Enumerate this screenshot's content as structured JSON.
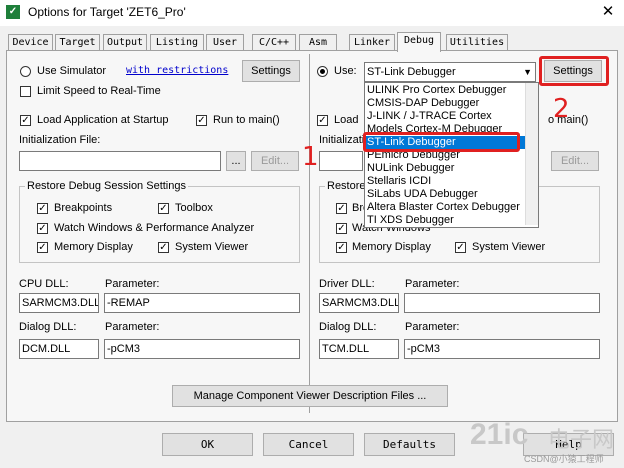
{
  "window": {
    "title": "Options for Target 'ZET6_Pro'",
    "close_glyph": "✕",
    "icon_glyph": "✓"
  },
  "tabs": [
    {
      "label": "Device"
    },
    {
      "label": "Target"
    },
    {
      "label": "Output"
    },
    {
      "label": "Listing"
    },
    {
      "label": "User"
    },
    {
      "label": "C/C++"
    },
    {
      "label": "Asm"
    },
    {
      "label": "Linker"
    },
    {
      "label": "Debug",
      "active": true
    },
    {
      "label": "Utilities"
    }
  ],
  "left": {
    "use_simulator": "Use Simulator",
    "with_restrictions": "with restrictions",
    "settings": "Settings",
    "limit_speed": "Limit Speed to Real-Time",
    "load_app": "Load Application at Startup",
    "run_to_main": "Run to main()",
    "init_file": "Initialization File:",
    "browse": "...",
    "edit": "Edit...",
    "restore_title": "Restore Debug Session Settings",
    "breakpoints": "Breakpoints",
    "toolbox": "Toolbox",
    "watch": "Watch Windows & Performance Analyzer",
    "memory": "Memory Display",
    "system_viewer": "System Viewer",
    "cpu_dll_label": "CPU DLL:",
    "param_label": "Parameter:",
    "cpu_dll": "SARMCM3.DLL",
    "cpu_param": "-REMAP",
    "dialog_dll_label": "Dialog DLL:",
    "dialog_dll": "DCM.DLL",
    "dialog_param": "-pCM3"
  },
  "right": {
    "use": "Use:",
    "debugger_selected": "ST-Link Debugger",
    "settings": "Settings",
    "load": "Load",
    "run_to_main_partial": "o main()",
    "init_partial": "Initializati",
    "edit": "Edit...",
    "restore_partial": "Restore",
    "breakpoints_partial": "Bre",
    "watch_partial": "Watch Windows",
    "memory": "Memory Display",
    "system_viewer": "System Viewer",
    "driver_dll_label": "Driver DLL:",
    "param_label": "Parameter:",
    "driver_dll": "SARMCM3.DLL",
    "driver_param": "",
    "dialog_dll_label": "Dialog DLL:",
    "dialog_dll": "TCM.DLL",
    "dialog_param": "-pCM3"
  },
  "dropdown": {
    "items": [
      "ULINK Pro Cortex Debugger",
      "CMSIS-DAP Debugger",
      "J-LINK / J-TRACE Cortex",
      "Models Cortex-M Debugger",
      "ST-Link Debugger",
      "PEmicro Debugger",
      "NULink Debugger",
      "Stellaris ICDI",
      "SiLabs UDA Debugger",
      "Altera Blaster Cortex Debugger",
      "TI XDS Debugger"
    ],
    "selected_index": 4
  },
  "manage_button": "Manage Component Viewer Description Files ...",
  "bottom": {
    "ok": "OK",
    "cancel": "Cancel",
    "defaults": "Defaults",
    "help": "Help"
  },
  "annotations": {
    "one": "1",
    "two": "2"
  },
  "watermark": {
    "text1": "21ic",
    "text2": "电子网",
    "text3": "CSDN@小猿工程师"
  },
  "check_glyph": "✓",
  "arrow_glyph": "▼",
  "colors": {
    "annotation_red": "#e02020",
    "selection_blue": "#0078d7"
  }
}
